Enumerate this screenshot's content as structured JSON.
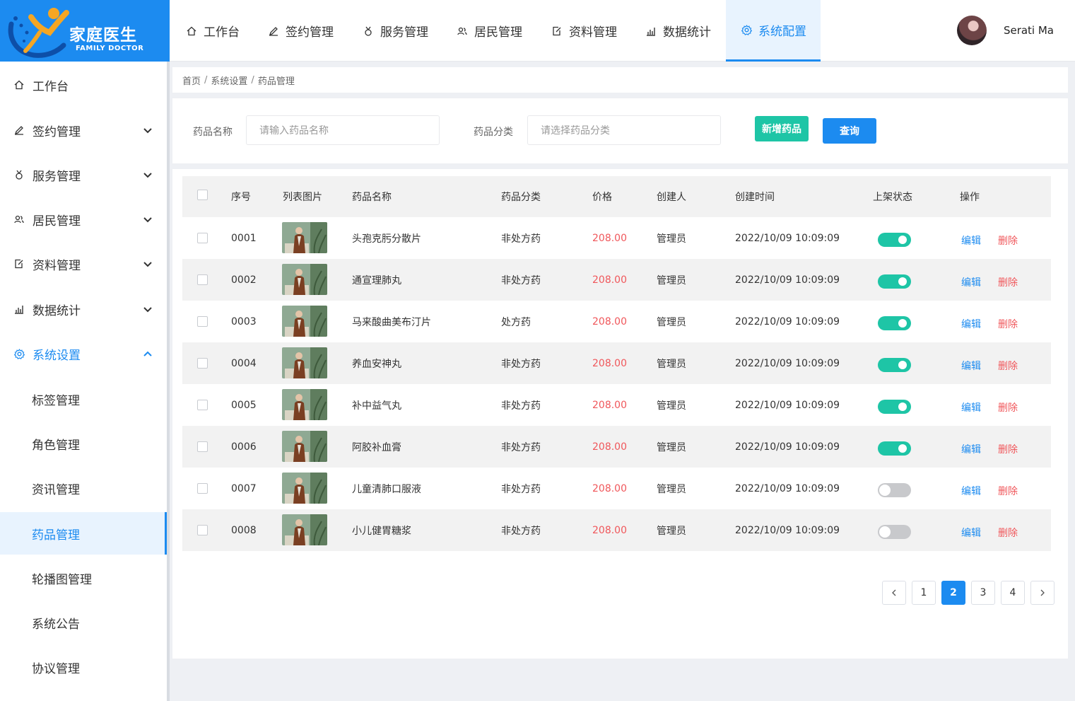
{
  "brand": {
    "name_cn": "家庭医生",
    "name_en": "FAMILY DOCTOR"
  },
  "topnav": [
    {
      "label": "工作台",
      "icon": "home-icon"
    },
    {
      "label": "签约管理",
      "icon": "edit-icon"
    },
    {
      "label": "服务管理",
      "icon": "medal-icon"
    },
    {
      "label": "居民管理",
      "icon": "users-icon"
    },
    {
      "label": "资料管理",
      "icon": "document-edit-icon"
    },
    {
      "label": "数据统计",
      "icon": "bar-chart-icon"
    },
    {
      "label": "系统配置",
      "icon": "gear-icon"
    }
  ],
  "user": {
    "name": "Serati Ma"
  },
  "sidebar": {
    "items": [
      {
        "label": "工作台"
      },
      {
        "label": "签约管理"
      },
      {
        "label": "服务管理"
      },
      {
        "label": "居民管理"
      },
      {
        "label": "资料管理"
      },
      {
        "label": "数据统计"
      },
      {
        "label": "系统设置"
      }
    ],
    "sub": [
      {
        "label": "标签管理"
      },
      {
        "label": "角色管理"
      },
      {
        "label": "资讯管理"
      },
      {
        "label": "药品管理"
      },
      {
        "label": "轮播图管理"
      },
      {
        "label": "系统公告"
      },
      {
        "label": "协议管理"
      }
    ]
  },
  "breadcrumb": [
    "首页",
    "系统设置",
    "药品管理"
  ],
  "search": {
    "name_label": "药品名称",
    "name_placeholder": "请输入药品名称",
    "category_label": "药品分类",
    "category_placeholder": "请选择药品分类",
    "add_button": "新增药品",
    "query_button": "查询"
  },
  "table": {
    "headers": [
      "序号",
      "列表图片",
      "药品名称",
      "药品分类",
      "价格",
      "创建人",
      "创建时间",
      "上架状态",
      "操作"
    ],
    "edit_label": "编辑",
    "delete_label": "删除",
    "rows": [
      {
        "id": "0001",
        "name": "头孢克肟分散片",
        "category": "非处方药",
        "price": "208.00",
        "creator": "管理员",
        "time": "2022/10/09 10:09:09",
        "listed": true
      },
      {
        "id": "0002",
        "name": "通宣理肺丸",
        "category": "非处方药",
        "price": "208.00",
        "creator": "管理员",
        "time": "2022/10/09 10:09:09",
        "listed": true
      },
      {
        "id": "0003",
        "name": "马来酸曲美布汀片",
        "category": "处方药",
        "price": "208.00",
        "creator": "管理员",
        "time": "2022/10/09 10:09:09",
        "listed": true
      },
      {
        "id": "0004",
        "name": "养血安神丸",
        "category": "非处方药",
        "price": "208.00",
        "creator": "管理员",
        "time": "2022/10/09 10:09:09",
        "listed": true
      },
      {
        "id": "0005",
        "name": "补中益气丸",
        "category": "非处方药",
        "price": "208.00",
        "creator": "管理员",
        "time": "2022/10/09 10:09:09",
        "listed": true
      },
      {
        "id": "0006",
        "name": "阿胶补血膏",
        "category": "非处方药",
        "price": "208.00",
        "creator": "管理员",
        "time": "2022/10/09 10:09:09",
        "listed": true
      },
      {
        "id": "0007",
        "name": "儿童清肺口服液",
        "category": "非处方药",
        "price": "208.00",
        "creator": "管理员",
        "time": "2022/10/09 10:09:09",
        "listed": false
      },
      {
        "id": "0008",
        "name": "小儿健胃糖浆",
        "category": "非处方药",
        "price": "208.00",
        "creator": "管理员",
        "time": "2022/10/09 10:09:09",
        "listed": false
      }
    ]
  },
  "pagination": {
    "pages": [
      "1",
      "2",
      "3",
      "4"
    ],
    "current": "2"
  },
  "colors": {
    "primary": "#1c8bf0",
    "success": "#1ec5a6",
    "danger": "#f0575b"
  }
}
